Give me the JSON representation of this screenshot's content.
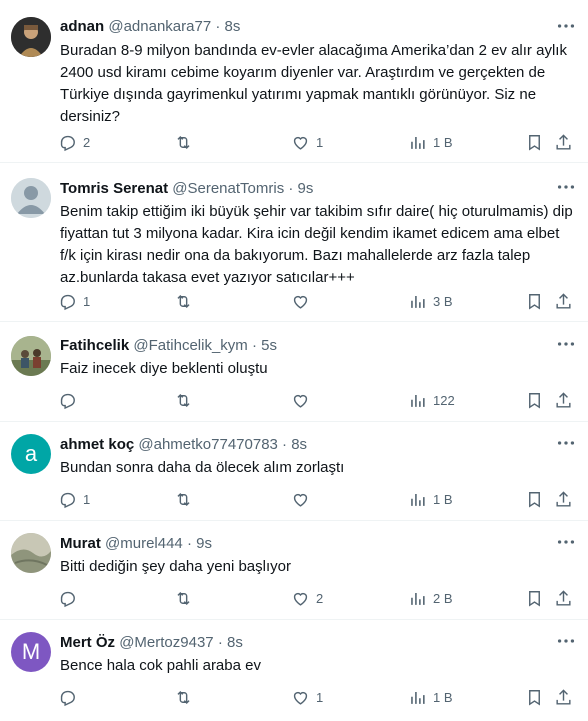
{
  "tweets": [
    {
      "name": "adnan",
      "handle": "@adnankara77",
      "dot": "·",
      "time": "8s",
      "text": "Buradan 8-9 milyon bandında ev-evler alacağıma Amerika’dan 2 ev alır aylık 2400 usd kiramı cebime koyarım diyenler var. Araştırdım ve gerçekten de Türkiye dışında gayrimenkul yatırımı yapmak mantıklı görünüyor. Siz ne dersiniz?",
      "replies": "2",
      "retweets": "",
      "likes": "1",
      "views": "1 B",
      "avatar_color": "#3b3b3b",
      "avatar_kind": "photo"
    },
    {
      "name": "Tomris Serenat",
      "handle": "@SerenatTomris",
      "dot": "·",
      "time": "9s",
      "text": "Benim takip ettiğim iki büyük şehir var takibim sıfır daire( hiç oturulmamis) dip fiyattan tut 3 milyona kadar. Kira icin değil kendim ikamet edicem ama elbet f/k için kirası nedir ona da bakıyorum. Bazı mahallelerde arz fazla talep az.bunlarda takasa evet yazıyor satıcılar+++",
      "replies": "1",
      "retweets": "",
      "likes": "",
      "views": "3 B",
      "avatar_color": "#cfd9de",
      "avatar_kind": "default"
    },
    {
      "name": "Fatihcelik",
      "handle": "@Fatihcelik_kym",
      "dot": "·",
      "time": "5s",
      "text": "Faiz inecek diye beklenti oluştu",
      "replies": "",
      "retweets": "",
      "likes": "",
      "views": "122",
      "avatar_color": "#7d8c6a",
      "avatar_kind": "photo"
    },
    {
      "name": "ahmet koç",
      "handle": "@ahmetko77470783",
      "dot": "·",
      "time": "8s",
      "text": "Bundan sonra daha da ölecek alım zorlaştı",
      "replies": "1",
      "retweets": "",
      "likes": "",
      "views": "1 B",
      "avatar_color": "#00a6a6",
      "avatar_kind": "letter",
      "avatar_letter": "a"
    },
    {
      "name": "Murat",
      "handle": "@murel444",
      "dot": "·",
      "time": "9s",
      "text": "Bitti dediğin şey daha yeni başlıyor",
      "replies": "",
      "retweets": "",
      "likes": "2",
      "views": "2 B",
      "avatar_color": "#a9ab9a",
      "avatar_kind": "photo"
    },
    {
      "name": "Mert Öz",
      "handle": "@Mertoz9437",
      "dot": "·",
      "time": "8s",
      "text": "Bence hala cok pahli araba ev",
      "replies": "",
      "retweets": "",
      "likes": "1",
      "views": "1 B",
      "avatar_color": "#7e57c2",
      "avatar_kind": "letter",
      "avatar_letter": "M"
    }
  ]
}
